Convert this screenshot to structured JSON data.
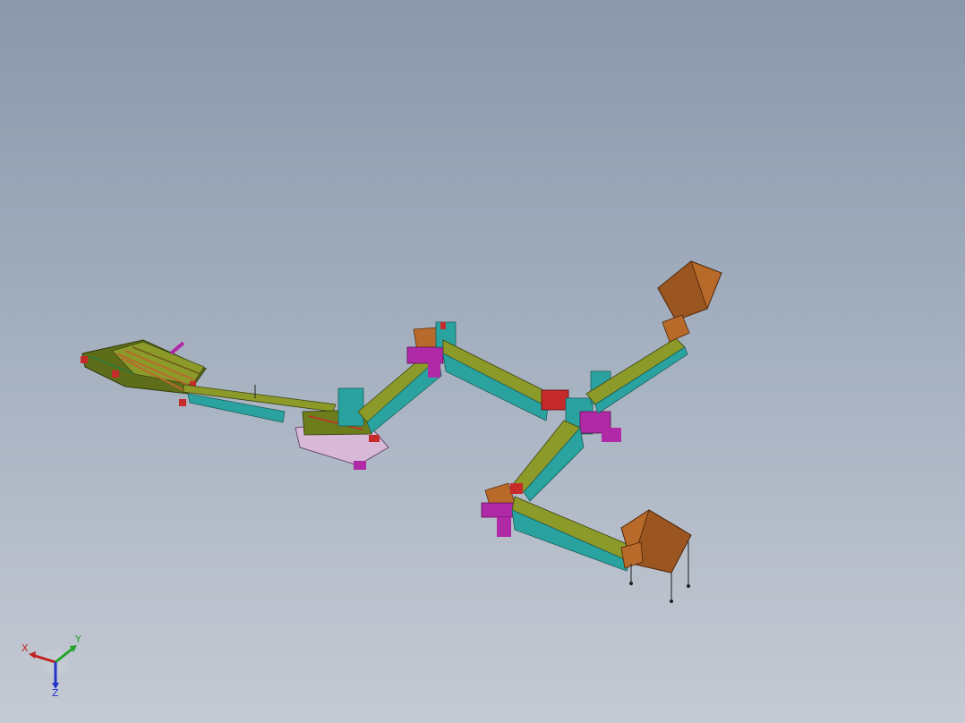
{
  "viewport": {
    "background_top": "#8a98aa",
    "background_bottom": "#c5cad3"
  },
  "model": {
    "description_colors": {
      "frame_green": "#6e7d1c",
      "frame_olive": "#8c9a2a",
      "frame_teal": "#2aa3a0",
      "hopper_brown": "#b86a2a",
      "motor_magenta": "#b02aa8",
      "motor_red": "#c62a2a",
      "leg_black": "#202020"
    }
  },
  "triad": {
    "x_label": "X",
    "y_label": "Y",
    "z_label": "Z",
    "x_color": "#c22020",
    "y_color": "#22a22a",
    "z_color": "#2233cc"
  }
}
